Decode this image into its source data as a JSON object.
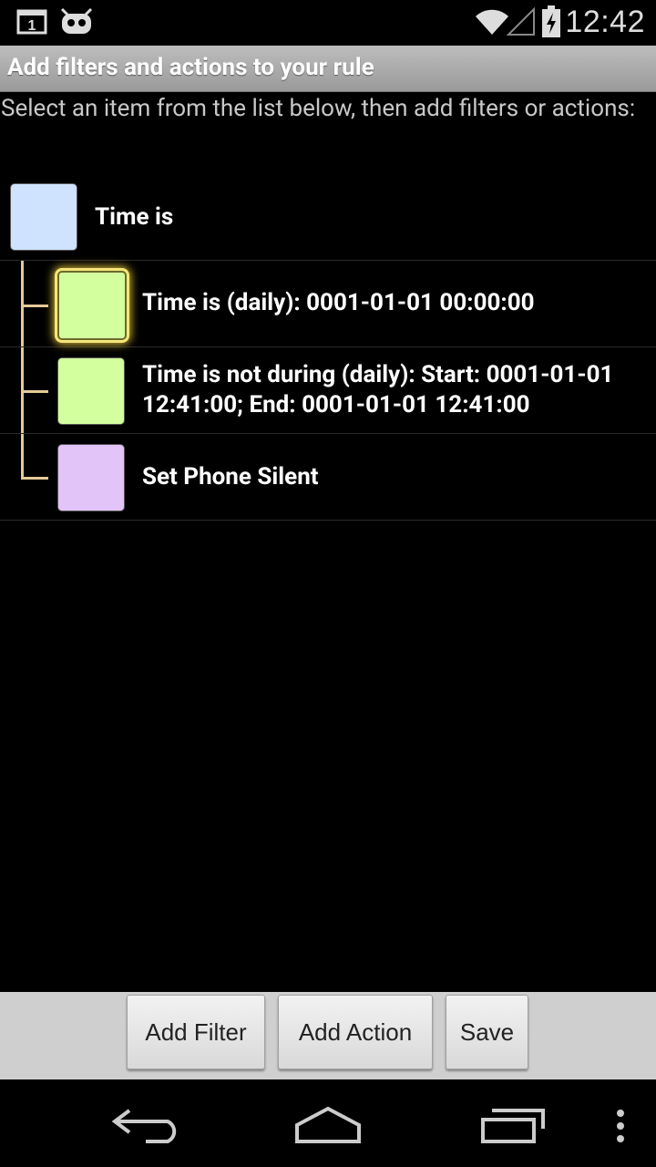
{
  "status_bar": {
    "time": "12:42",
    "notification_badge": "1",
    "icons": [
      "calendar-notification-icon",
      "cyanogen-mascot-icon",
      "wifi-icon",
      "cell-signal-icon",
      "battery-charging-icon"
    ]
  },
  "title": "Add filters and actions to your rule",
  "instructions": "Select an item from the list below, then add filters or actions:",
  "list": {
    "root": {
      "label": "Time is",
      "color": "#cfe3ff"
    },
    "children": [
      {
        "label": "Time is (daily): 0001-01-01 00:00:00",
        "color": "#d4ff9e",
        "selected": true
      },
      {
        "label": "Time is not during (daily): Start: 0001-01-01 12:41:00; End: 0001-01-01 12:41:00",
        "color": "#d4ff9e",
        "selected": false
      },
      {
        "label": "Set Phone Silent",
        "color": "#e3c4f9",
        "selected": false
      }
    ],
    "tree_line_color": "#e5c998"
  },
  "buttons": {
    "add_filter": "Add Filter",
    "add_action": "Add Action",
    "save": "Save"
  },
  "nav": [
    "back-icon",
    "home-icon",
    "recent-apps-icon",
    "overflow-menu-icon"
  ]
}
